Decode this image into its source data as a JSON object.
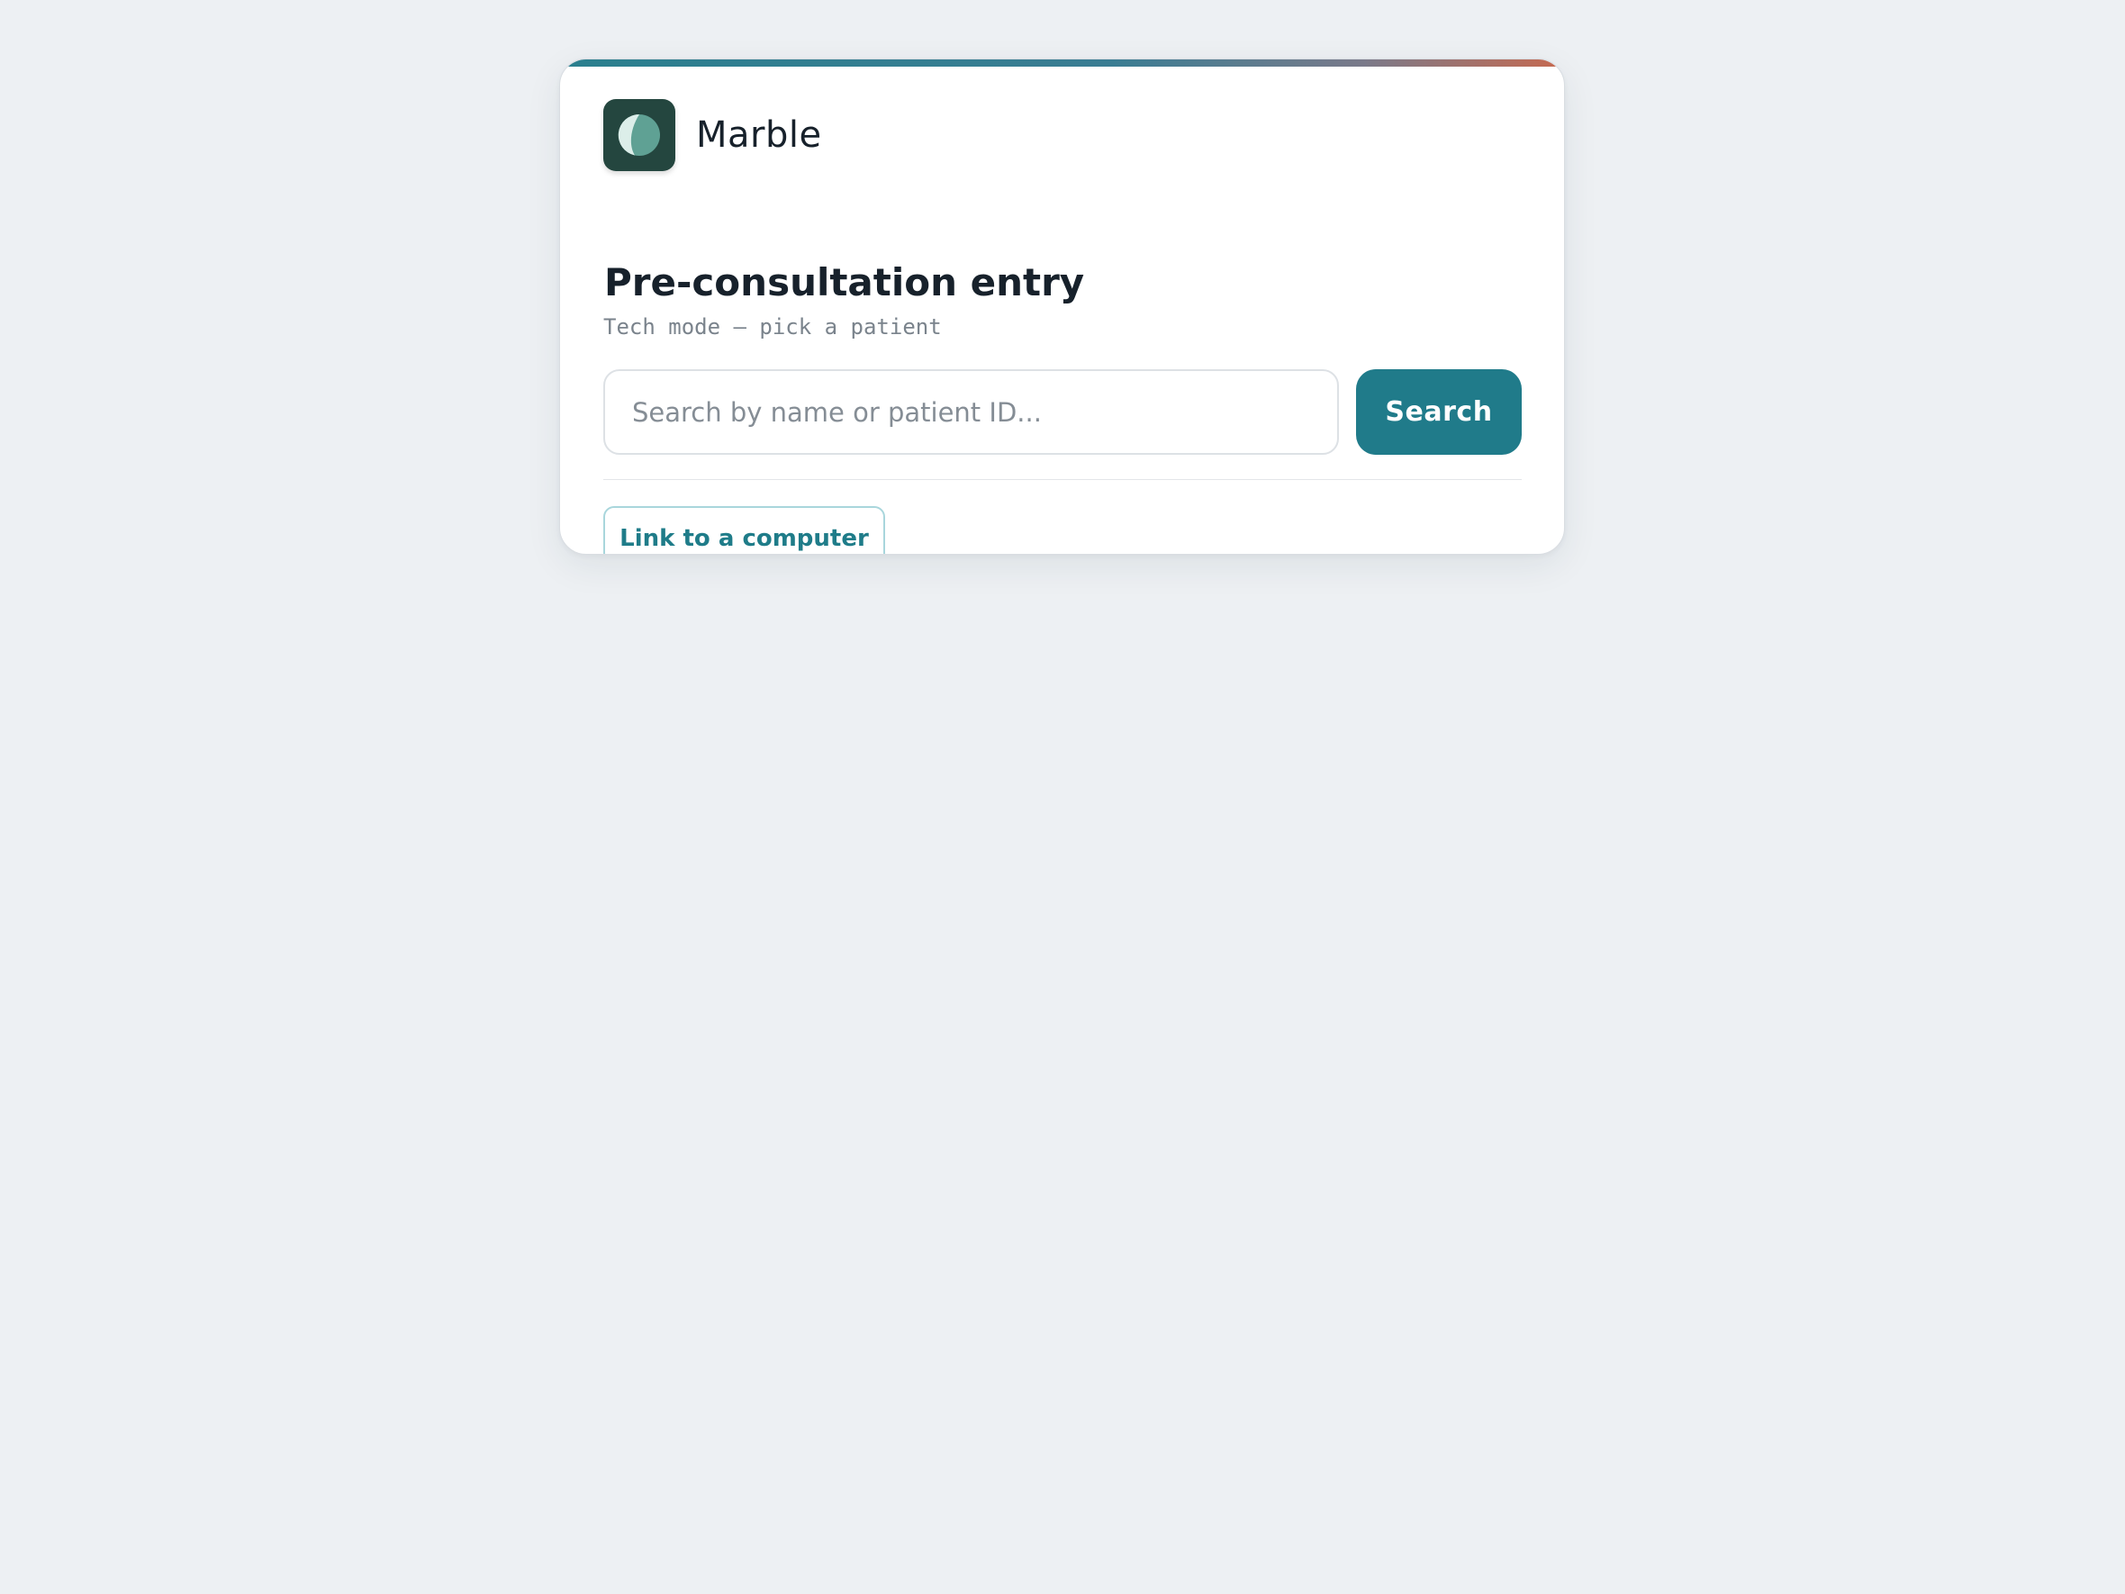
{
  "brand": {
    "name": "Marble",
    "logo_icon": "half-moon-circle-icon",
    "logo_bg": "#24463f"
  },
  "page": {
    "title": "Pre-consultation entry",
    "subtitle": "Tech mode — pick a patient"
  },
  "search": {
    "placeholder": "Search by name or patient ID...",
    "value": "",
    "button_label": "Search"
  },
  "actions": {
    "link_computer_label": "Link to a computer"
  },
  "colors": {
    "accent": "#207b8a",
    "background": "#edf0f3",
    "accent_gradient_start": "#2a7f8e",
    "accent_gradient_end": "#c7694f"
  }
}
